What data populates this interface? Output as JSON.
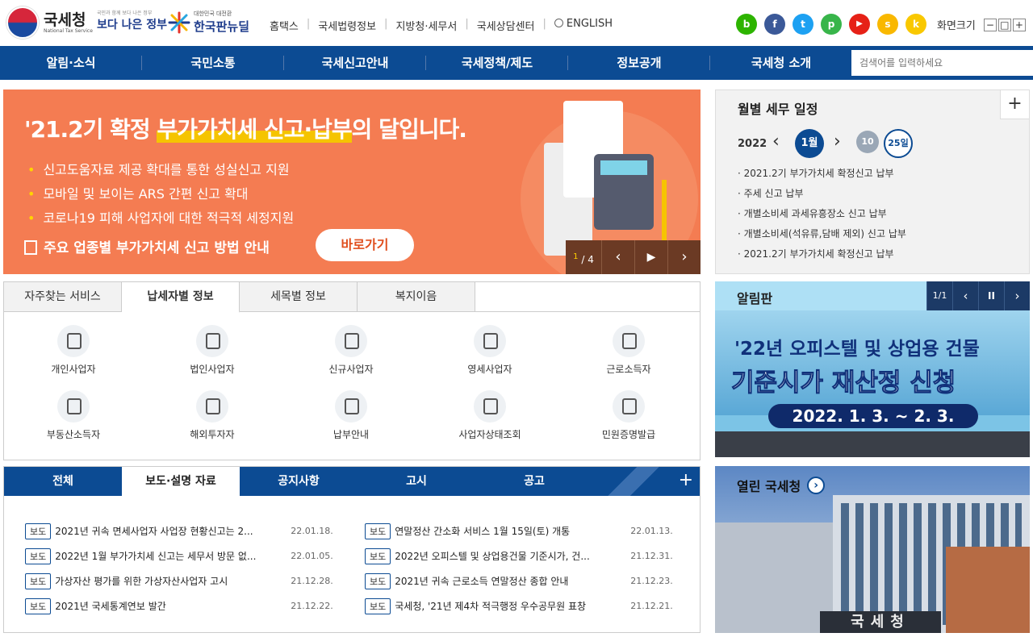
{
  "header": {
    "logo_ko": "국세청",
    "logo_en": "National Tax Service",
    "gov_sub": "국민과 함께 보다 나은 정부",
    "gov_main": "보다 나은 정부",
    "newdeal_sub": "대한민국 대전환",
    "newdeal_main": "한국판뉴딜",
    "links": [
      "홈택스",
      "국세법령정보",
      "지방청·세무서",
      "국세상담센터",
      "ENGLISH"
    ],
    "social": [
      {
        "name": "blog",
        "color": "#2db400",
        "label": "b"
      },
      {
        "name": "facebook",
        "color": "#3b5998",
        "label": "f"
      },
      {
        "name": "twitter",
        "color": "#1da1f2",
        "label": "t"
      },
      {
        "name": "post",
        "color": "#38b54a",
        "label": "p"
      },
      {
        "name": "youtube",
        "color": "#e62117",
        "label": "▶"
      },
      {
        "name": "kakaostory",
        "color": "#f9b800",
        "label": "s"
      },
      {
        "name": "kakaochannel",
        "color": "#f9c800",
        "label": "k"
      }
    ],
    "zoom_label": "화면크기",
    "zoom_buttons": [
      "−",
      "□",
      "+"
    ]
  },
  "gnb": {
    "menu": [
      "알림·소식",
      "국민소통",
      "국세신고안내",
      "국세정책/제도",
      "정보공개",
      "국세청 소개"
    ],
    "search_placeholder": "검색어를 입력하세요"
  },
  "banner": {
    "headline_prefix": "'21.2기 확정 ",
    "headline_highlight": "부가가치세 신고·납부",
    "headline_suffix": "의 달입니다.",
    "bullets": [
      "신고도움자료 제공 확대를 통한 성실신고 지원",
      "모바일 및 보이는 ARS 간편 신고 확대",
      "코로나19 피해 사업자에 대한 적극적 세정지원"
    ],
    "guide": "주요 업종별 부가가치세 신고 방법 안내",
    "go_button": "바로가기",
    "page_current": "1",
    "page_total": "/ 4",
    "prev": "‹",
    "play": "▶",
    "next": "›"
  },
  "schedule": {
    "title": "월별 세무 일정",
    "plus": "+",
    "year": "2022",
    "prev": "‹",
    "next": "›",
    "month": "1월",
    "day1": "10",
    "day2": "25일",
    "items": [
      "2021.2기 부가가치세 확정신고 납부",
      "주세 신고 납부",
      "개별소비세 과세유흥장소 신고 납부",
      "개별소비세(석유류,담배 제외) 신고 납부",
      "2021.2기 부가가치세 확정신고 납부"
    ]
  },
  "services": {
    "tabs": [
      "자주찾는 서비스",
      "납세자별 정보",
      "세목별 정보",
      "복지이음"
    ],
    "active_tab": 1,
    "items": [
      "개인사업자",
      "법인사업자",
      "신규사업자",
      "영세사업자",
      "근로소득자",
      "부동산소득자",
      "해외투자자",
      "납부안내",
      "사업자상태조회",
      "민원증명발급"
    ]
  },
  "news": {
    "tabs": [
      "전체",
      "보도·설명 자료",
      "공지사항",
      "고시",
      "공고"
    ],
    "active_tab": 1,
    "plus": "+",
    "left": [
      {
        "tag": "보도",
        "text": "2021년 귀속 면세사업자 사업장 현황신고는 2...",
        "date": "22.01.18."
      },
      {
        "tag": "보도",
        "text": "2022년 1월 부가가치세 신고는 세무서 방문 없...",
        "date": "22.01.05."
      },
      {
        "tag": "보도",
        "text": "가상자산 평가를 위한 가상자산사업자 고시",
        "date": "21.12.28."
      },
      {
        "tag": "보도",
        "text": "2021년 국세통계연보 발간",
        "date": "21.12.22."
      }
    ],
    "right": [
      {
        "tag": "보도",
        "text": "연말정산 간소화 서비스 1월 15일(토) 개통",
        "date": "22.01.13."
      },
      {
        "tag": "보도",
        "text": "2022년 오피스텔 및 상업용건물 기준시가, 건...",
        "date": "21.12.31."
      },
      {
        "tag": "보도",
        "text": "2021년 귀속 근로소득 연말정산 종합 안내",
        "date": "21.12.23."
      },
      {
        "tag": "보도",
        "text": "국세청, '21년 제4차 적극행정 우수공무원 표창",
        "date": "21.12.21."
      }
    ]
  },
  "notice": {
    "title": "알림판",
    "page": "1/1",
    "prev": "‹",
    "pause": "II",
    "next": "›",
    "line1": "'22년 오피스텔 및 상업용 건물",
    "line2": "기준시가 재산정 신청",
    "line3": "2022. 1. 3. ~ 2. 3."
  },
  "open": {
    "title": "열린 국세청",
    "more": "›",
    "sign": "국세청"
  }
}
